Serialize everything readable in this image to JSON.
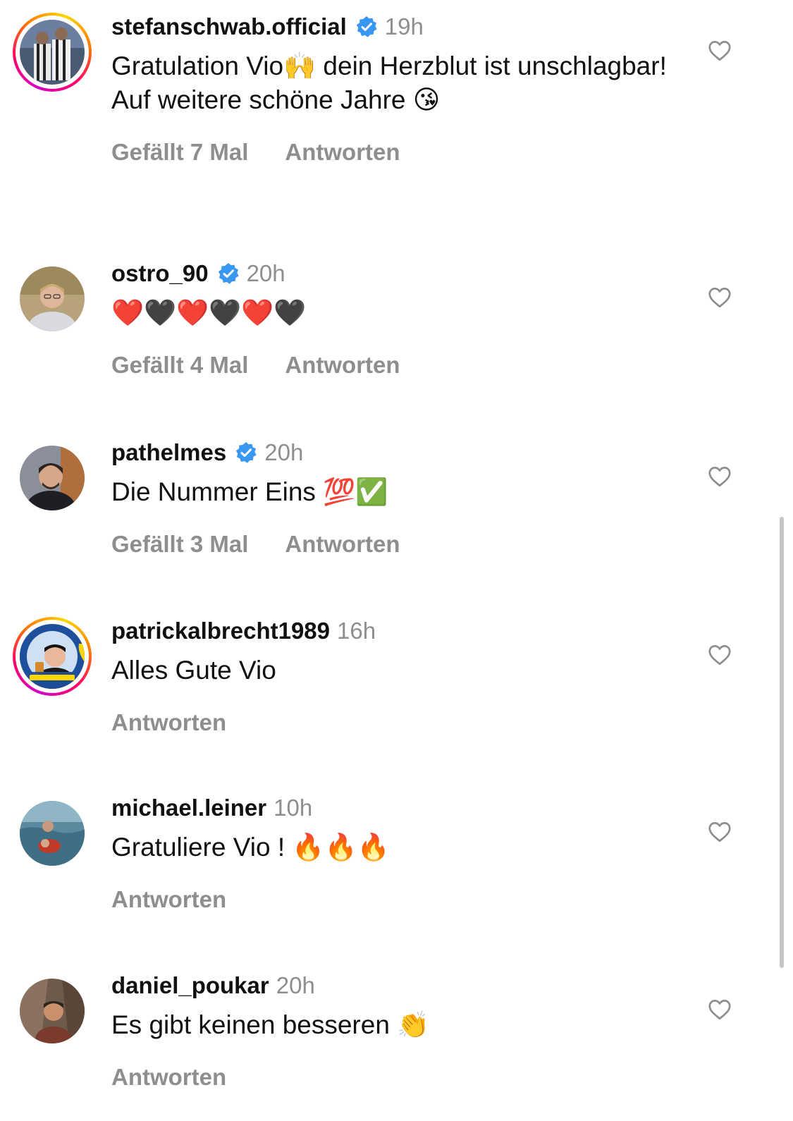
{
  "comments": [
    {
      "username": "stefanschwab.official",
      "verified": true,
      "time": "19h",
      "text": "Gratulation Vio🙌 dein Herzblut ist unschlagbar! Auf weitere schöne Jahre 😘",
      "likes": "Gefällt 7 Mal",
      "reply": "Antworten"
    },
    {
      "username": "ostro_90",
      "verified": true,
      "time": "20h",
      "text": "❤️🖤❤️🖤❤️🖤",
      "likes": "Gefällt 4 Mal",
      "reply": "Antworten"
    },
    {
      "username": "pathelmes",
      "verified": true,
      "time": "20h",
      "text": "Die Nummer Eins 💯✅",
      "likes": "Gefällt 3 Mal",
      "reply": "Antworten"
    },
    {
      "username": "patrickalbrecht1989",
      "verified": false,
      "time": "16h",
      "text": "Alles Gute Vio",
      "likes": "",
      "reply": "Antworten",
      "avatar_badge": "#StandWithUkraine"
    },
    {
      "username": "michael.leiner",
      "verified": false,
      "time": "10h",
      "text": "Gratuliere Vio ! 🔥🔥🔥",
      "likes": "",
      "reply": "Antworten"
    },
    {
      "username": "daniel_poukar",
      "verified": false,
      "time": "20h",
      "text": "Es gibt keinen besseren 👏",
      "likes": "",
      "reply": "Antworten"
    }
  ],
  "icons": {
    "verified": "verified-badge-icon",
    "like": "heart-outline-icon"
  },
  "colors": {
    "verified_blue": "#3897f0",
    "secondary_text": "#8e8e8e",
    "primary_text": "#111111"
  }
}
